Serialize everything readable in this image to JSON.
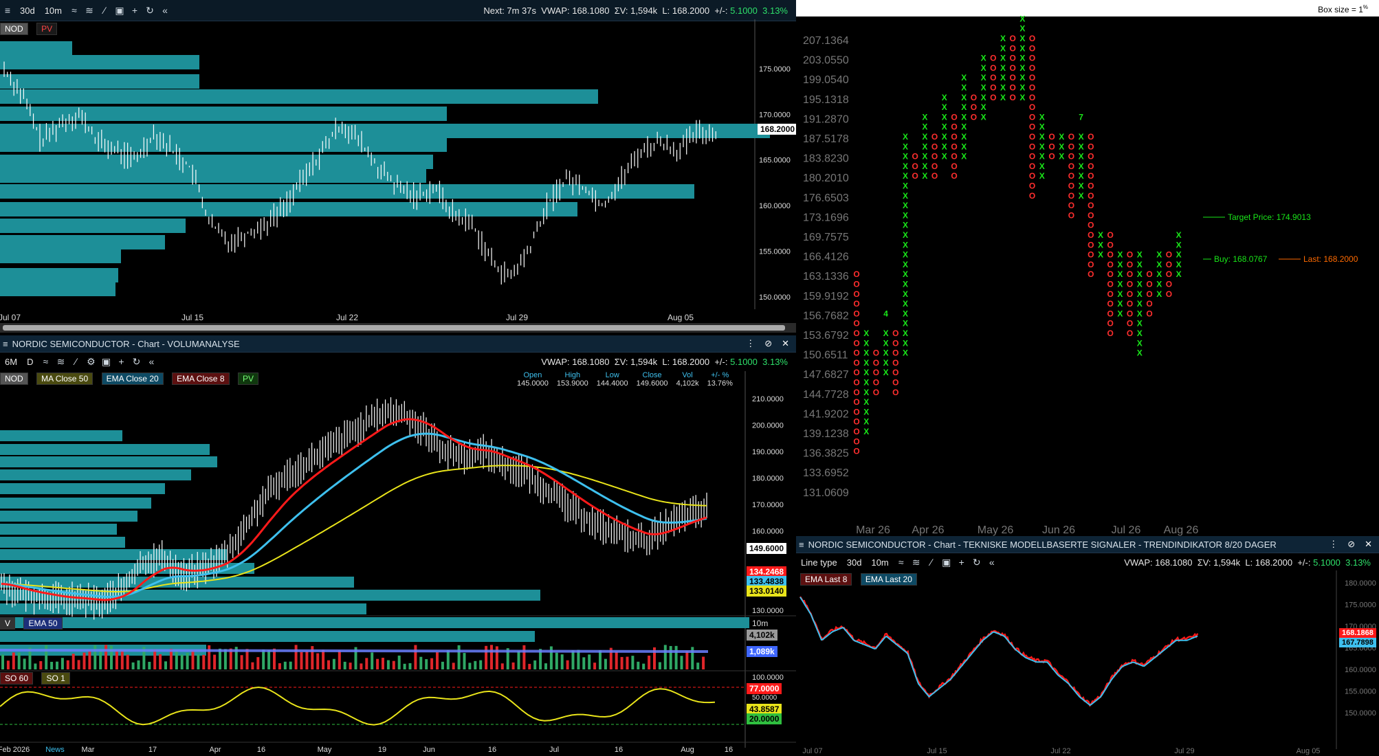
{
  "top_toolbar": {
    "periods": [
      "30d",
      "10m"
    ],
    "status_next": "Next: 7m 37s",
    "status_vwap": "VWAP: 168.1080",
    "status_sv": "ΣV: 1,594k",
    "status_last": "L: 168.2000",
    "status_change_label": "+/-:",
    "status_change": "5.1000",
    "status_change_pct": "3.13%"
  },
  "chart1": {
    "legend": [
      "NOD",
      "PV"
    ],
    "y_ticks": [
      "175.0000",
      "170.0000",
      "165.0000",
      "160.0000",
      "155.0000",
      "150.0000"
    ],
    "x_ticks": [
      "Jul 07",
      "Jul 15",
      "Jul 22",
      "Jul 29",
      "Aug 05"
    ],
    "last_price_tag": "168.2000"
  },
  "volume_panel": {
    "title": "NORDIC SEMICONDUCTOR - Chart - VOLUMANALYSE",
    "periods": [
      "6M",
      "D"
    ],
    "status_vwap": "VWAP: 168.1080",
    "status_sv": "ΣV: 1,594k",
    "status_last": "L: 168.2000",
    "status_change_label": "+/-:",
    "status_change": "5.1000",
    "status_change_pct": "3.13%",
    "legend": [
      "NOD",
      "MA Close 50",
      "EMA Close 20",
      "EMA Close 8",
      "PV"
    ],
    "ohlc_headers": [
      "Open",
      "High",
      "Low",
      "Close",
      "Vol",
      "+/- %"
    ],
    "ohlc_values": [
      "145.0000",
      "153.9000",
      "144.4000",
      "149.6000",
      "4,102k",
      "13.76%"
    ],
    "y_ticks": [
      "210.0000",
      "200.0000",
      "190.0000",
      "180.0000",
      "170.0000",
      "160.0000",
      "130.0000"
    ],
    "price_tags": {
      "last": "149.6000",
      "ema8": "134.2468",
      "ema20": "133.4838",
      "ma50": "133.0140"
    },
    "vol_legend": [
      "V",
      "EMA 50"
    ],
    "vol_period": "10m",
    "vol_tags": {
      "vol": "4,102k",
      "ema": "1,089k"
    },
    "so_legend": [
      "SO 60",
      "SO 1"
    ],
    "so_ticks": [
      "100.0000",
      "50.0000"
    ],
    "so_tags": {
      "upper": "77.0000",
      "value": "43.8587",
      "lower": "20.0000"
    },
    "x_ticks": [
      "Feb 2026",
      "News",
      "Mar",
      "17",
      "Apr",
      "16",
      "May",
      "19",
      "Jun",
      "16",
      "Jul",
      "16",
      "Aug",
      "16"
    ]
  },
  "pf_panel": {
    "box_size_label": "Box size = 1",
    "box_size_unit": "%",
    "y_ticks": [
      "207.1364",
      "203.0550",
      "199.0540",
      "195.1318",
      "191.2870",
      "187.5178",
      "183.8230",
      "180.2010",
      "176.6503",
      "173.1696",
      "169.7575",
      "166.4126",
      "163.1336",
      "159.9192",
      "156.7682",
      "153.6792",
      "150.6511",
      "147.6827",
      "144.7728",
      "141.9202",
      "139.1238",
      "136.3825",
      "133.6952",
      "131.0609"
    ],
    "x_ticks": [
      "Mar 26",
      "Apr 26",
      "May 26",
      "Jun 26",
      "Jul 26",
      "Aug 26"
    ],
    "target_label": "Target Price: 174.9013",
    "buy_label": "Buy: 168.0767",
    "last_label": "Last: 168.2000",
    "columns": [
      {
        "type": "O",
        "top": 163.1336,
        "bottom": 136.3825
      },
      {
        "type": "X",
        "top": 153.6792,
        "bottom": 139.1238
      },
      {
        "type": "O",
        "top": 150.6511,
        "bottom": 144.7728
      },
      {
        "type": "X",
        "top": 153.6792,
        "bottom": 147.6827
      },
      {
        "type": "O",
        "top": 153.6792,
        "bottom": 144.7728
      },
      {
        "type": "X",
        "top": 187.5178,
        "bottom": 150.6511
      },
      {
        "type": "O",
        "top": 183.823,
        "bottom": 180.201
      },
      {
        "type": "X",
        "top": 191.287,
        "bottom": 180.201
      },
      {
        "type": "O",
        "top": 187.5178,
        "bottom": 180.201
      },
      {
        "type": "X",
        "top": 195.1318,
        "bottom": 183.823
      },
      {
        "type": "O",
        "top": 191.287,
        "bottom": 180.201
      },
      {
        "type": "X",
        "top": 199.054,
        "bottom": 183.823
      },
      {
        "type": "O",
        "top": 195.1318,
        "bottom": 191.287
      },
      {
        "type": "X",
        "top": 203.055,
        "bottom": 191.287
      },
      {
        "type": "O",
        "top": 203.055,
        "bottom": 195.1318
      },
      {
        "type": "X",
        "top": 207.1364,
        "bottom": 195.1318
      },
      {
        "type": "O",
        "top": 207.1364,
        "bottom": 195.1318
      },
      {
        "type": "X",
        "top": 211.3,
        "bottom": 195.1318
      },
      {
        "type": "O",
        "top": 207.1364,
        "bottom": 176.6503
      },
      {
        "type": "X",
        "top": 191.287,
        "bottom": 180.201
      },
      {
        "type": "O",
        "top": 187.5178,
        "bottom": 183.823
      },
      {
        "type": "X",
        "top": 187.5178,
        "bottom": 183.823
      },
      {
        "type": "O",
        "top": 187.5178,
        "bottom": 173.1696
      },
      {
        "type": "X",
        "top": 187.5178,
        "bottom": 176.6503
      },
      {
        "type": "O",
        "top": 187.5178,
        "bottom": 163.1336
      },
      {
        "type": "X",
        "top": 169.7575,
        "bottom": 166.4126
      },
      {
        "type": "O",
        "top": 169.7575,
        "bottom": 153.6792
      },
      {
        "type": "X",
        "top": 166.4126,
        "bottom": 156.7682
      },
      {
        "type": "O",
        "top": 166.4126,
        "bottom": 153.6792
      },
      {
        "type": "X",
        "top": 166.4126,
        "bottom": 150.6511
      },
      {
        "type": "O",
        "top": 163.1336,
        "bottom": 156.7682
      },
      {
        "type": "X",
        "top": 166.4126,
        "bottom": 159.9192
      },
      {
        "type": "O",
        "top": 166.4126,
        "bottom": 159.9192
      },
      {
        "type": "X",
        "top": 169.7575,
        "bottom": 163.1336
      }
    ],
    "digits": [
      {
        "text": "4",
        "col": 3,
        "price": 156.7682
      },
      {
        "text": "7",
        "col": 23,
        "price": 191.287
      }
    ]
  },
  "trend_panel": {
    "title": "NORDIC SEMICONDUCTOR - Chart - TEKNISKE MODELLBASERTE SIGNALER - TRENDINDIKATOR 8/20 DAGER",
    "line_type_label": "Line type",
    "periods": [
      "30d",
      "10m"
    ],
    "status_vwap": "VWAP: 168.1080",
    "status_sv": "ΣV: 1,594k",
    "status_last": "L: 168.2000",
    "status_change_label": "+/-:",
    "status_change": "5.1000",
    "status_change_pct": "3.13%",
    "legend": [
      "EMA Last 8",
      "EMA Last 20"
    ],
    "y_ticks": [
      "180.0000",
      "175.0000",
      "170.0000",
      "165.0000",
      "160.0000",
      "155.0000",
      "150.0000"
    ],
    "tags": {
      "ema8": "168.1868",
      "ema20": "167.7898"
    },
    "x_ticks": [
      "Jul 07",
      "Jul 15",
      "Jul 22",
      "Jul 29",
      "Aug 05"
    ]
  },
  "colors": {
    "teal_bar": "#1d8f98",
    "candle": "#ffffff",
    "ema8": "#ff1a1a",
    "ema20": "#3ec0ee",
    "ma50": "#e9e41a",
    "x_mark": "#19e619",
    "o_mark": "#ff2e2e",
    "vol_up": "#2fa865",
    "vol_down": "#e0262a"
  }
}
